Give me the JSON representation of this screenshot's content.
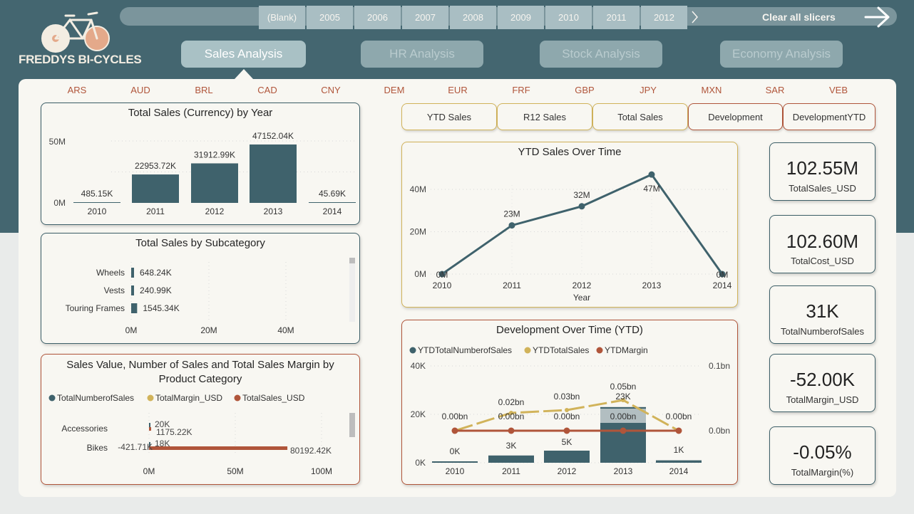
{
  "colors": {
    "teal": "#446670",
    "bar": "#3f626c",
    "rust": "#b0553a",
    "gold": "#d1b35a",
    "panel": "#f8f7f2"
  },
  "logo": {
    "text": "FREDDYS BI-CYCLES",
    "icon": "bicycle-icon"
  },
  "slicer": {
    "years": [
      "(Blank)",
      "2005",
      "2006",
      "2007",
      "2008",
      "2009",
      "2010",
      "2011",
      "2012"
    ],
    "clear_label": "Clear all slicers",
    "next_icon": "chevron-right-icon",
    "arrow_icon": "arrow-right-icon"
  },
  "tabs": [
    "Sales Analysis",
    "HR Analysis",
    "Stock Analysis",
    "Economy Analysis"
  ],
  "currencies": [
    "ARS",
    "AUD",
    "BRL",
    "CAD",
    "CNY",
    "DEM",
    "EUR",
    "FRF",
    "GBP",
    "JPY",
    "MXN",
    "SAR",
    "VEB"
  ],
  "measure_buttons": [
    "YTD Sales",
    "R12 Sales",
    "Total Sales",
    "Development",
    "DevelopmentYTD"
  ],
  "kpis": [
    {
      "value": "102.55M",
      "label": "TotalSales_USD"
    },
    {
      "value": "102.60M",
      "label": "TotalCost_USD"
    },
    {
      "value": "31K",
      "label": "TotalNumberofSales"
    },
    {
      "value": "-52.00K",
      "label": "TotalMargin_USD"
    },
    {
      "value": "-0.05%",
      "label": "TotalMargin(%)"
    }
  ],
  "chart_data": [
    {
      "type": "bar",
      "title": "Total Sales (Currency) by Year",
      "categories": [
        "2010",
        "2011",
        "2012",
        "2013",
        "2014"
      ],
      "values": [
        485.15,
        22953.72,
        31912.99,
        47152.04,
        45.69
      ],
      "value_unit": "K",
      "data_labels": [
        "485.15K",
        "22953.72K",
        "31912.99K",
        "47152.04K",
        "45.69K"
      ],
      "y_ticks": [
        "50M",
        "0M"
      ],
      "ylim": [
        0,
        50000
      ]
    },
    {
      "type": "bar",
      "orientation": "horizontal",
      "title": "Total Sales by Subcategory",
      "categories": [
        "Wheels",
        "Vests",
        "Touring Frames"
      ],
      "values": [
        648.24,
        240.99,
        1545.34
      ],
      "data_labels": [
        "648.24K",
        "240.99K",
        "1545.34K"
      ],
      "x_ticks": [
        "0M",
        "20M",
        "40M"
      ],
      "xlim": [
        0,
        50000
      ]
    },
    {
      "type": "bar",
      "orientation": "horizontal",
      "title": "Sales Value, Number of Sales and Total Sales Margin by Product Category",
      "legend": [
        "TotalNumberofSales",
        "TotalMargin_USD",
        "TotalSales_USD"
      ],
      "categories": [
        "Accessories",
        "Bikes"
      ],
      "series": [
        {
          "name": "TotalNumberofSales",
          "values": [
            20,
            18
          ],
          "labels": [
            "20K",
            "18K"
          ]
        },
        {
          "name": "TotalMargin_USD",
          "values": [
            0,
            -421.71
          ],
          "labels": [
            "",
            "-421.71K"
          ]
        },
        {
          "name": "TotalSales_USD",
          "values": [
            1175.22,
            80192.42
          ],
          "labels": [
            "1175.22K",
            "80192.42K"
          ]
        }
      ],
      "x_ticks": [
        "0M",
        "50M",
        "100M"
      ]
    },
    {
      "type": "line",
      "title": "YTD Sales Over Time",
      "xlabel": "Year",
      "x": [
        "2010",
        "2011",
        "2012",
        "2013",
        "2014"
      ],
      "values": [
        0,
        23,
        32,
        47,
        0
      ],
      "data_labels": [
        "0M",
        "23M",
        "32M",
        "47M",
        "0M"
      ],
      "y_ticks": [
        "40M",
        "20M",
        "0M"
      ],
      "ylim": [
        0,
        50
      ]
    },
    {
      "type": "bar",
      "title": "Development Over Time (YTD)",
      "legend": [
        "YTDTotalNumberofSales",
        "YTDTotalSales",
        "YTDMargin"
      ],
      "x": [
        "2010",
        "2011",
        "2012",
        "2013",
        "2014"
      ],
      "series": [
        {
          "name": "YTDTotalNumberofSales",
          "values": [
            0,
            3,
            5,
            23,
            1
          ],
          "labels": [
            "0K",
            "3K",
            "5K",
            "23K",
            "1K"
          ]
        },
        {
          "name": "YTDTotalSales",
          "values": [
            0.0,
            0.02,
            0.03,
            0.05,
            0.0
          ],
          "labels": [
            "0.00bn",
            "0.02bn",
            "0.03bn",
            "0.05bn",
            "0.00bn"
          ]
        },
        {
          "name": "YTDMargin",
          "values": [
            0,
            0,
            0,
            0,
            0
          ],
          "labels": [
            "0.00bn",
            "0.00bn",
            "0.00bn",
            "0.00bn",
            ""
          ]
        }
      ],
      "y_ticks_left": [
        "40K",
        "20K",
        "0K"
      ],
      "y_ticks_right": [
        "0.1bn",
        "0.0bn"
      ]
    }
  ]
}
